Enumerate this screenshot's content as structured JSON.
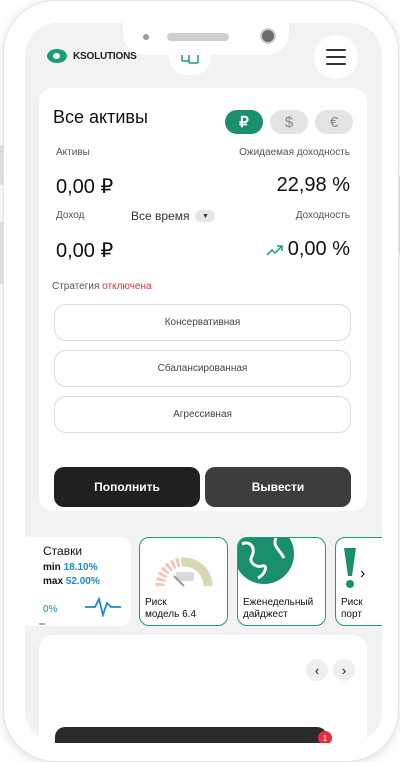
{
  "header": {
    "logo_text": "KSOLUTIONS",
    "menu_icon": "hamburger-menu-icon",
    "top_icon": "card-icon"
  },
  "assets": {
    "title": "Все активы",
    "currencies": [
      "₽",
      "$",
      "€"
    ],
    "selected_currency": "₽",
    "assets_label": "Активы",
    "assets_value": "0,00 ₽",
    "expected_yield_label": "Ожидаемая доходность",
    "expected_yield_value": "22,98 %",
    "income_label": "Доход",
    "period_select": "Все время",
    "income_value": "0,00 ₽",
    "yield_label": "Доходность",
    "yield_value": "0,00 %",
    "strategy_label": "Стратегия",
    "strategy_status": "отключена",
    "options": [
      "Консервативная",
      "Сбалансированная",
      "Агрессивная"
    ],
    "deposit_button": "Пополнить",
    "withdraw_button": "Вывести"
  },
  "tiles": {
    "rates_title": "Ставки",
    "rates_min_label": "min",
    "rates_min_value": "18.10%",
    "rates_max_label": "max",
    "rates_max_value": "52.00%",
    "rates_pct": "0%",
    "risk_caption_1": "Риск",
    "risk_caption_2": "модель 6.4",
    "digest_caption_1": "Еженедельный",
    "digest_caption_2": "дайджест",
    "portfolio_caption_1": "Риск",
    "portfolio_caption_2": "порт"
  },
  "bottom": {
    "badge_count": "1"
  },
  "colors": {
    "accent": "#1a8f6e",
    "danger": "#e0303e",
    "link": "#1e88c8"
  }
}
